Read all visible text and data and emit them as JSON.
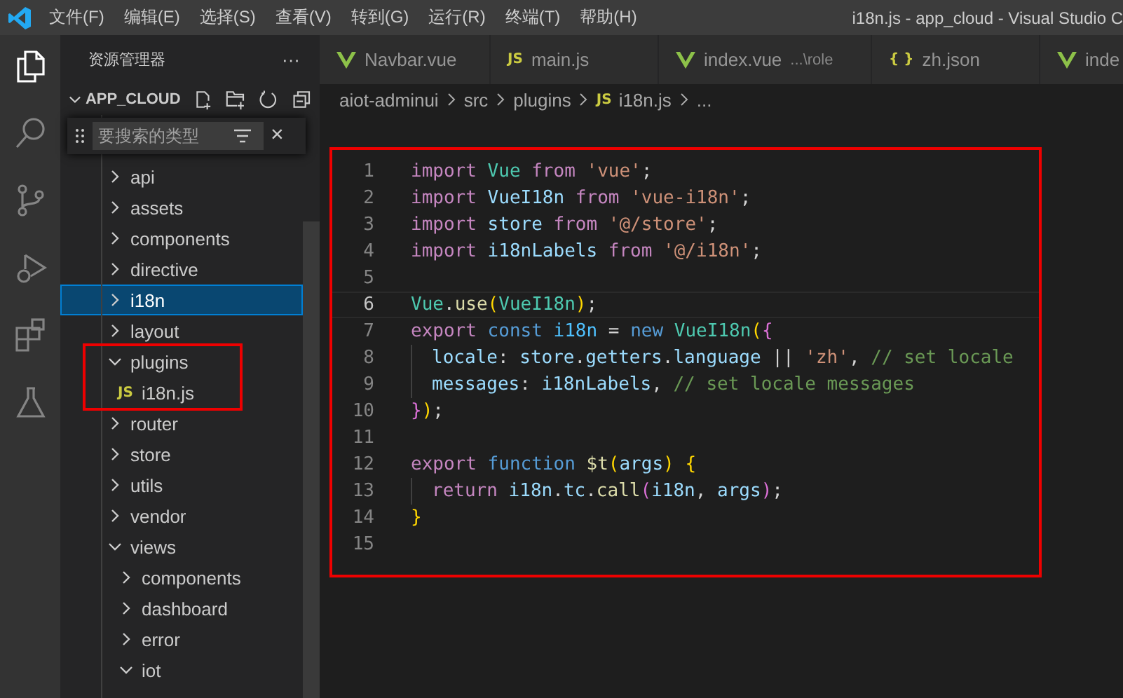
{
  "menu": [
    "文件(F)",
    "编辑(E)",
    "选择(S)",
    "查看(V)",
    "转到(G)",
    "运行(R)",
    "终端(T)",
    "帮助(H)"
  ],
  "window": {
    "title": "i18n.js - app_cloud - Visual Studio C"
  },
  "activity_bar": [
    {
      "kind": "files",
      "selected": true
    },
    {
      "kind": "search",
      "selected": false
    },
    {
      "kind": "git",
      "selected": false
    },
    {
      "kind": "debug",
      "selected": false
    },
    {
      "kind": "extensions",
      "selected": false
    },
    {
      "kind": "flask",
      "selected": false
    }
  ],
  "sidebar": {
    "title": "资源管理器",
    "more": "···",
    "folder": "APP_CLOUD",
    "find": {
      "placeholder": "要搜索的类型",
      "close": "×"
    },
    "tree": [
      {
        "label": "api",
        "expanded": false,
        "selected": false,
        "highlighted": false
      },
      {
        "label": "assets",
        "expanded": false,
        "selected": false,
        "highlighted": false
      },
      {
        "label": "components",
        "expanded": false,
        "selected": false,
        "highlighted": false
      },
      {
        "label": "directive",
        "expanded": false,
        "selected": false,
        "highlighted": false
      },
      {
        "label": "i18n",
        "expanded": false,
        "selected": true,
        "highlighted": false
      },
      {
        "label": "layout",
        "expanded": false,
        "selected": false,
        "highlighted": false
      },
      {
        "label": "plugins",
        "expanded": true,
        "selected": false,
        "highlighted": true,
        "children": [
          {
            "label": "i18n.js",
            "icon": "JS",
            "selected": false
          }
        ]
      },
      {
        "label": "router",
        "expanded": false,
        "selected": false,
        "highlighted": false
      },
      {
        "label": "store",
        "expanded": false,
        "selected": false,
        "highlighted": false
      },
      {
        "label": "utils",
        "expanded": false,
        "selected": false,
        "highlighted": false
      },
      {
        "label": "vendor",
        "expanded": false,
        "selected": false,
        "highlighted": false
      },
      {
        "label": "views",
        "expanded": true,
        "selected": false,
        "highlighted": false,
        "children": [
          {
            "label": "components",
            "expanded": false,
            "selected": false
          },
          {
            "label": "dashboard",
            "expanded": false,
            "selected": false
          },
          {
            "label": "error",
            "expanded": false,
            "selected": false
          },
          {
            "label": "iot",
            "expanded": true,
            "selected": false
          }
        ]
      }
    ]
  },
  "tabs": [
    {
      "label": "Navbar.vue",
      "kind": "vue",
      "selected": false
    },
    {
      "label": "main.js",
      "kind": "text",
      "icon": "JS",
      "selected": false
    },
    {
      "label": "index.vue",
      "detail": "...\\role",
      "kind": "vue",
      "selected": false
    },
    {
      "label": "zh.json",
      "kind": "text",
      "icon": "{ }",
      "selected": false
    },
    {
      "label": "inde",
      "kind": "vue",
      "selected": false
    }
  ],
  "breadcrumb": [
    {
      "label": "aiot-adminui"
    },
    {
      "label": "src"
    },
    {
      "label": "plugins"
    },
    {
      "label": "i18n.js",
      "icon": "JS"
    },
    {
      "label": "..."
    }
  ],
  "editor": {
    "highlighted": true,
    "lines": [
      {
        "number": "1",
        "current": false,
        "guide": false,
        "tokens": [
          {
            "text": "import ",
            "kind": "keyword"
          },
          {
            "text": "Vue ",
            "kind": "class"
          },
          {
            "text": "from ",
            "kind": "keyword"
          },
          {
            "text": "'vue'",
            "kind": "string"
          },
          {
            "text": ";",
            "kind": "plain"
          }
        ]
      },
      {
        "number": "2",
        "current": false,
        "guide": false,
        "tokens": [
          {
            "text": "import ",
            "kind": "keyword"
          },
          {
            "text": "VueI18n ",
            "kind": "variable"
          },
          {
            "text": "from ",
            "kind": "keyword"
          },
          {
            "text": "'vue-i18n'",
            "kind": "string"
          },
          {
            "text": ";",
            "kind": "plain"
          }
        ]
      },
      {
        "number": "3",
        "current": false,
        "guide": false,
        "tokens": [
          {
            "text": "import ",
            "kind": "keyword"
          },
          {
            "text": "store ",
            "kind": "variable"
          },
          {
            "text": "from ",
            "kind": "keyword"
          },
          {
            "text": "'@/store'",
            "kind": "string"
          },
          {
            "text": ";",
            "kind": "plain"
          }
        ]
      },
      {
        "number": "4",
        "current": false,
        "guide": false,
        "tokens": [
          {
            "text": "import ",
            "kind": "keyword"
          },
          {
            "text": "i18nLabels ",
            "kind": "variable"
          },
          {
            "text": "from ",
            "kind": "keyword"
          },
          {
            "text": "'@/i18n'",
            "kind": "string"
          },
          {
            "text": ";",
            "kind": "plain"
          }
        ]
      },
      {
        "number": "5",
        "current": false,
        "guide": false
      },
      {
        "number": "6",
        "current": true,
        "guide": false,
        "tokens": [
          {
            "text": "Vue",
            "kind": "class"
          },
          {
            "text": ".",
            "kind": "plain"
          },
          {
            "text": "use",
            "kind": "function"
          },
          {
            "text": "(",
            "kind": "bracket"
          },
          {
            "text": "VueI18n",
            "kind": "class"
          },
          {
            "text": ")",
            "kind": "bracket"
          },
          {
            "text": ";",
            "kind": "plain"
          }
        ]
      },
      {
        "number": "7",
        "current": false,
        "guide": false,
        "tokens": [
          {
            "text": "export ",
            "kind": "keyword"
          },
          {
            "text": "const ",
            "kind": "storage"
          },
          {
            "text": "i18n ",
            "kind": "constant"
          },
          {
            "text": "= ",
            "kind": "plain"
          },
          {
            "text": "new ",
            "kind": "storage"
          },
          {
            "text": "VueI18n",
            "kind": "class"
          },
          {
            "text": "(",
            "kind": "bracket"
          },
          {
            "text": "{",
            "kind": "bracket2"
          }
        ]
      },
      {
        "number": "8",
        "current": false,
        "guide": true,
        "tokens": [
          {
            "text": "locale",
            "kind": "variable"
          },
          {
            "text": ": ",
            "kind": "plain"
          },
          {
            "text": "store",
            "kind": "variable"
          },
          {
            "text": ".",
            "kind": "plain"
          },
          {
            "text": "getters",
            "kind": "variable"
          },
          {
            "text": ".",
            "kind": "plain"
          },
          {
            "text": "language",
            "kind": "variable"
          },
          {
            "text": " || ",
            "kind": "plain"
          },
          {
            "text": "'zh'",
            "kind": "string"
          },
          {
            "text": ", ",
            "kind": "plain"
          },
          {
            "text": "// set locale",
            "kind": "comment"
          }
        ]
      },
      {
        "number": "9",
        "current": false,
        "guide": true,
        "tokens": [
          {
            "text": "messages",
            "kind": "variable"
          },
          {
            "text": ": ",
            "kind": "plain"
          },
          {
            "text": "i18nLabels",
            "kind": "variable"
          },
          {
            "text": ", ",
            "kind": "plain"
          },
          {
            "text": "// set locale messages",
            "kind": "comment"
          }
        ]
      },
      {
        "number": "10",
        "current": false,
        "guide": false,
        "tokens": [
          {
            "text": "}",
            "kind": "bracket2"
          },
          {
            "text": ")",
            "kind": "bracket"
          },
          {
            "text": ";",
            "kind": "plain"
          }
        ]
      },
      {
        "number": "11",
        "current": false,
        "guide": false
      },
      {
        "number": "12",
        "current": false,
        "guide": false,
        "tokens": [
          {
            "text": "export ",
            "kind": "keyword"
          },
          {
            "text": "function ",
            "kind": "storage"
          },
          {
            "text": "$t",
            "kind": "function"
          },
          {
            "text": "(",
            "kind": "bracket"
          },
          {
            "text": "args",
            "kind": "variable"
          },
          {
            "text": ") {",
            "kind": "bracket"
          }
        ]
      },
      {
        "number": "13",
        "current": false,
        "guide": true,
        "tokens": [
          {
            "text": "return ",
            "kind": "keyword"
          },
          {
            "text": "i18n",
            "kind": "variable"
          },
          {
            "text": ".",
            "kind": "plain"
          },
          {
            "text": "tc",
            "kind": "variable"
          },
          {
            "text": ".",
            "kind": "plain"
          },
          {
            "text": "call",
            "kind": "function"
          },
          {
            "text": "(",
            "kind": "bracket2"
          },
          {
            "text": "i18n",
            "kind": "variable"
          },
          {
            "text": ", ",
            "kind": "plain"
          },
          {
            "text": "args",
            "kind": "variable"
          },
          {
            "text": ")",
            "kind": "bracket2"
          },
          {
            "text": ";",
            "kind": "plain"
          }
        ]
      },
      {
        "number": "14",
        "current": false,
        "guide": false,
        "tokens": [
          {
            "text": "}",
            "kind": "bracket"
          }
        ]
      },
      {
        "number": "15",
        "current": false,
        "guide": false
      }
    ]
  }
}
